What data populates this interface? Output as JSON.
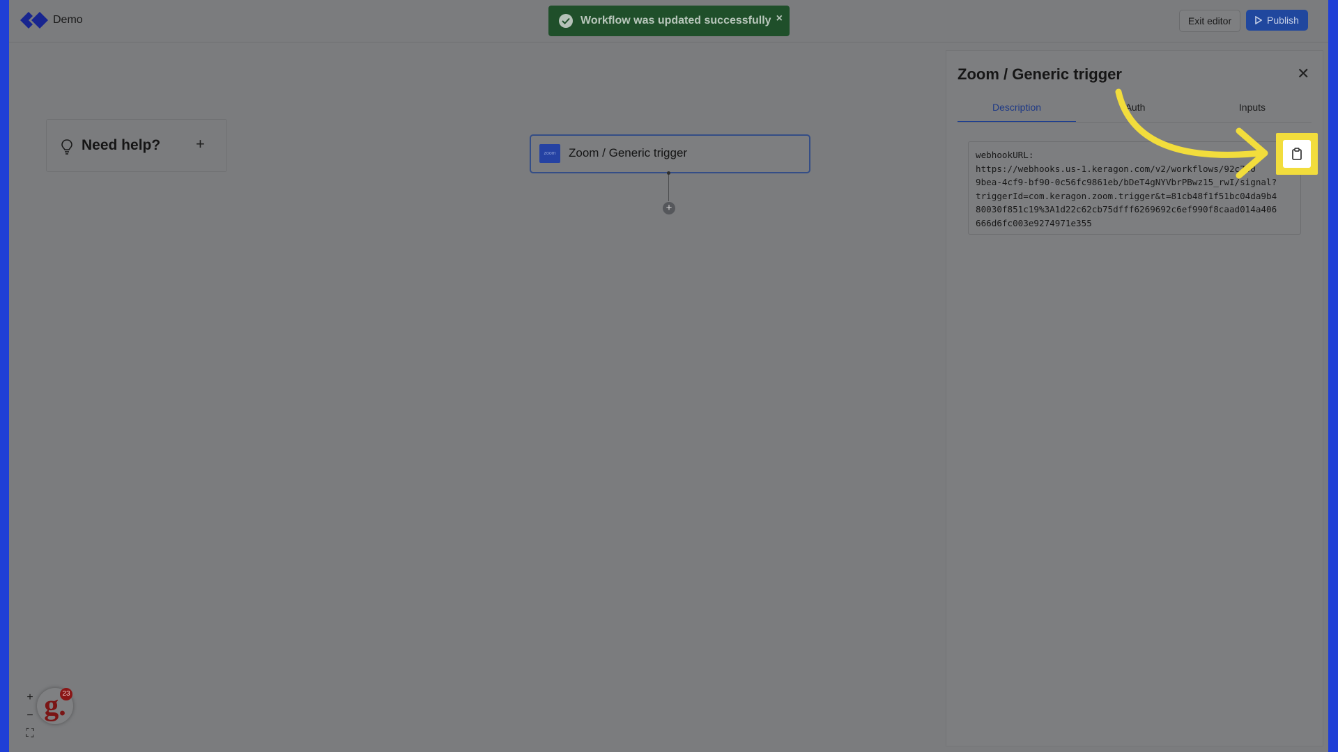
{
  "app": {
    "title": "Demo"
  },
  "toolbar": {
    "exit_label": "Exit editor",
    "publish_label": "Publish"
  },
  "toast": {
    "message": "Workflow was updated successfully",
    "close": "×"
  },
  "help": {
    "label": "Need help?",
    "plus": "+"
  },
  "node": {
    "logo_text": "zoom",
    "label": "Zoom / Generic trigger"
  },
  "add_step": "+",
  "panel": {
    "title": "Zoom / Generic trigger",
    "close": "✕",
    "tabs": [
      {
        "label": "Description",
        "active": true
      },
      {
        "label": "Auth",
        "active": false
      },
      {
        "label": "Inputs",
        "active": false
      }
    ],
    "code": "webhookURL:\nhttps://webhooks.us-1.keragon.com/v2/workflows/92c740\n9bea-4cf9-bf90-0c56fc9861eb/bDeT4gNYVbrPBwz15_rwI/signal?\ntriggerId=com.keragon.zoom.trigger&t=81cb48f1f51bc04da9b4\n80030f851c19%3A1d22c62cb75dfff6269692c6ef990f8caad014a406\n666d6fc003e9274971e355"
  },
  "zoom_controls": {
    "in": "+",
    "out": "−",
    "fit": "⛶"
  },
  "widget": {
    "letter": "g.",
    "badge": "23"
  },
  "colors": {
    "brand_blue": "#1f3fd6",
    "publish": "#20479e",
    "toast": "#1f4f2a",
    "highlight": "#f2dd3c",
    "badge": "#8a1616"
  }
}
